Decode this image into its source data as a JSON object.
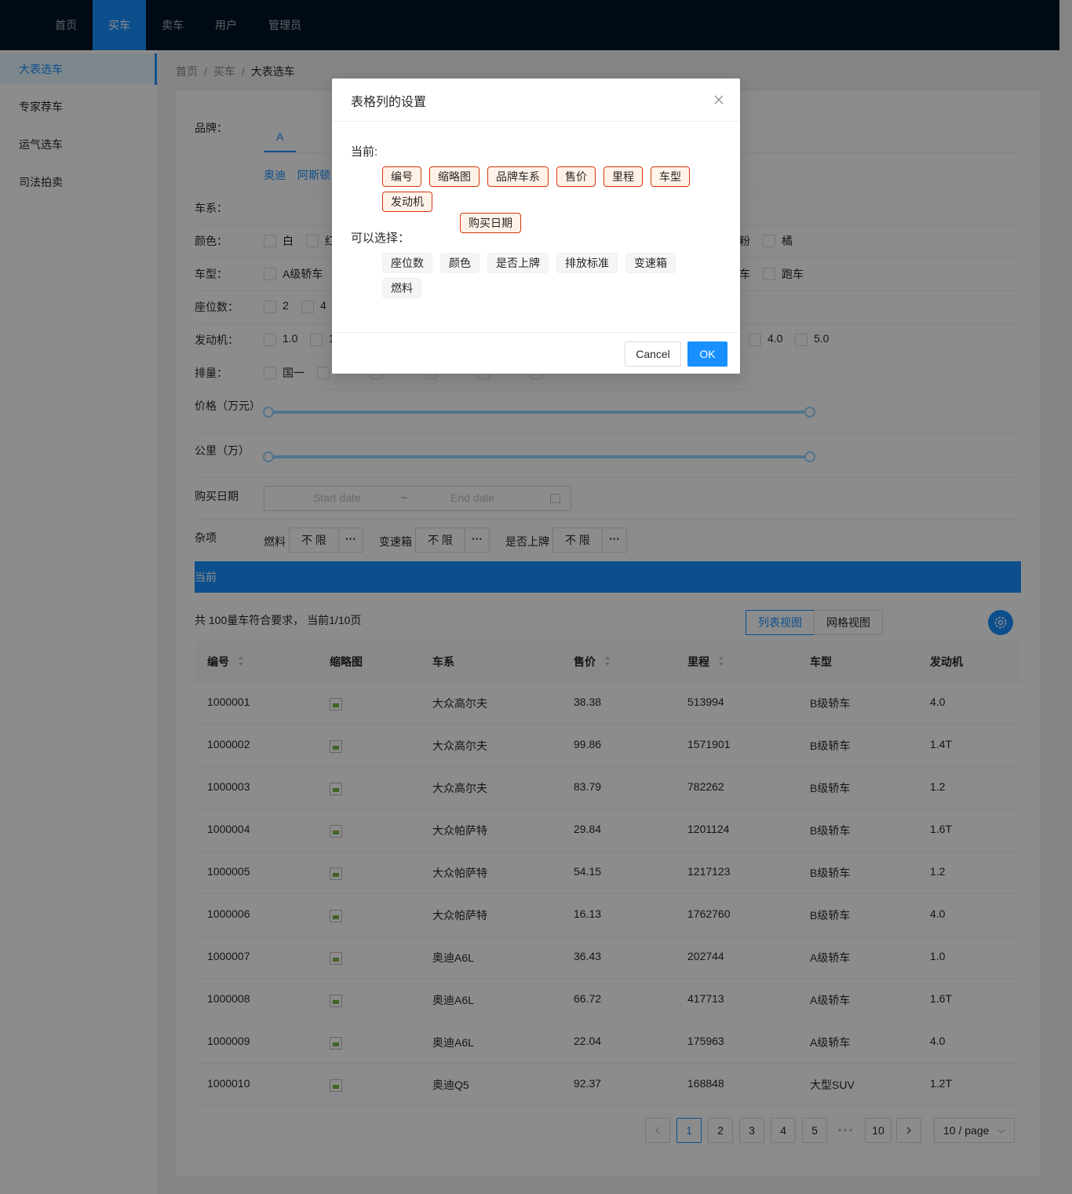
{
  "nav": {
    "items": [
      "首页",
      "买车",
      "卖车",
      "用户",
      "管理员"
    ],
    "active": "买车"
  },
  "sidebar": {
    "items": [
      "大表选车",
      "专家荐车",
      "运气选车",
      "司法拍卖"
    ]
  },
  "breadcrumb": [
    "首页",
    "买车",
    "大表选车"
  ],
  "filters": {
    "brand_label": "品牌：",
    "brand_tab": "A",
    "brand_names": [
      "奥迪",
      "阿斯顿"
    ],
    "series_label": "车系：",
    "color_label": "颜色：",
    "colors": [
      "白",
      "红",
      "粉",
      "橘"
    ],
    "type_label": "车型：",
    "types": [
      "A级轿车",
      "车",
      "跑车"
    ],
    "seats_label": "座位数：",
    "seats": [
      "2",
      "4"
    ],
    "engine_label": "发动机：",
    "engines": [
      "1.0",
      "1",
      "4.0",
      "5.0"
    ],
    "emission_label": "排量：",
    "emissions": [
      "国一"
    ],
    "price_label": "价格（万元）",
    "mileage_label": "公里（万）",
    "date_label": "购买日期",
    "start_date_placeholder": "Start date",
    "date_separator": "~",
    "end_date_placeholder": "End date",
    "misc_label": "杂项",
    "fuel_label": "燃料",
    "fuel_value": "不 限",
    "gearbox_label": "变速箱",
    "gearbox_value": "不 限",
    "plate_label": "是否上牌",
    "plate_value": "不 限",
    "more_symbol": "···"
  },
  "banner": {
    "text": "当前"
  },
  "summary": "共 100量车符合要求， 当前1/10页",
  "views": {
    "list": "列表视图",
    "grid": "网格视图"
  },
  "table": {
    "columns": [
      "编号",
      "缩略图",
      "车系",
      "售价",
      "里程",
      "车型",
      "发动机"
    ],
    "rows": [
      [
        "1000001",
        "大众高尔夫",
        "38.38",
        "513994",
        "B级轿车",
        "4.0"
      ],
      [
        "1000002",
        "大众高尔夫",
        "99.86",
        "1571901",
        "B级轿车",
        "1.4T"
      ],
      [
        "1000003",
        "大众高尔夫",
        "83.79",
        "782262",
        "B级轿车",
        "1.2"
      ],
      [
        "1000004",
        "大众帕萨特",
        "29.84",
        "1201124",
        "B级轿车",
        "1.6T"
      ],
      [
        "1000005",
        "大众帕萨特",
        "54.15",
        "1217123",
        "B级轿车",
        "1.2"
      ],
      [
        "1000006",
        "大众帕萨特",
        "16.13",
        "1762760",
        "B级轿车",
        "4.0"
      ],
      [
        "1000007",
        "奥迪A6L",
        "36.43",
        "202744",
        "A级轿车",
        "1.0"
      ],
      [
        "1000008",
        "奥迪A6L",
        "66.72",
        "417713",
        "A级轿车",
        "1.6T"
      ],
      [
        "1000009",
        "奥迪A6L",
        "22.04",
        "175963",
        "A级轿车",
        "4.0"
      ],
      [
        "1000010",
        "奥迪Q5",
        "92.37",
        "168848",
        "大型SUV",
        "1.2T"
      ]
    ]
  },
  "pagination": {
    "pages": [
      "1",
      "2",
      "3",
      "4",
      "5",
      "10"
    ],
    "current": "1",
    "dots": "•••",
    "page_size": "10 / page"
  },
  "modal": {
    "title": "表格列的设置",
    "current_label": "当前:",
    "current_tags": [
      "编号",
      "缩略图",
      "品牌车系",
      "售价",
      "里程",
      "车型",
      "发动机"
    ],
    "dragging_tag": "购买日期",
    "available_label": "可以选择：",
    "available_tags": [
      "座位数",
      "颜色",
      "是否上牌",
      "排放标准",
      "变速箱",
      "燃料"
    ],
    "cancel": "Cancel",
    "ok": "OK"
  },
  "colors": {
    "primary": "#1890ff",
    "nav_bg": "#001529",
    "tag_border": "#d4380d"
  }
}
